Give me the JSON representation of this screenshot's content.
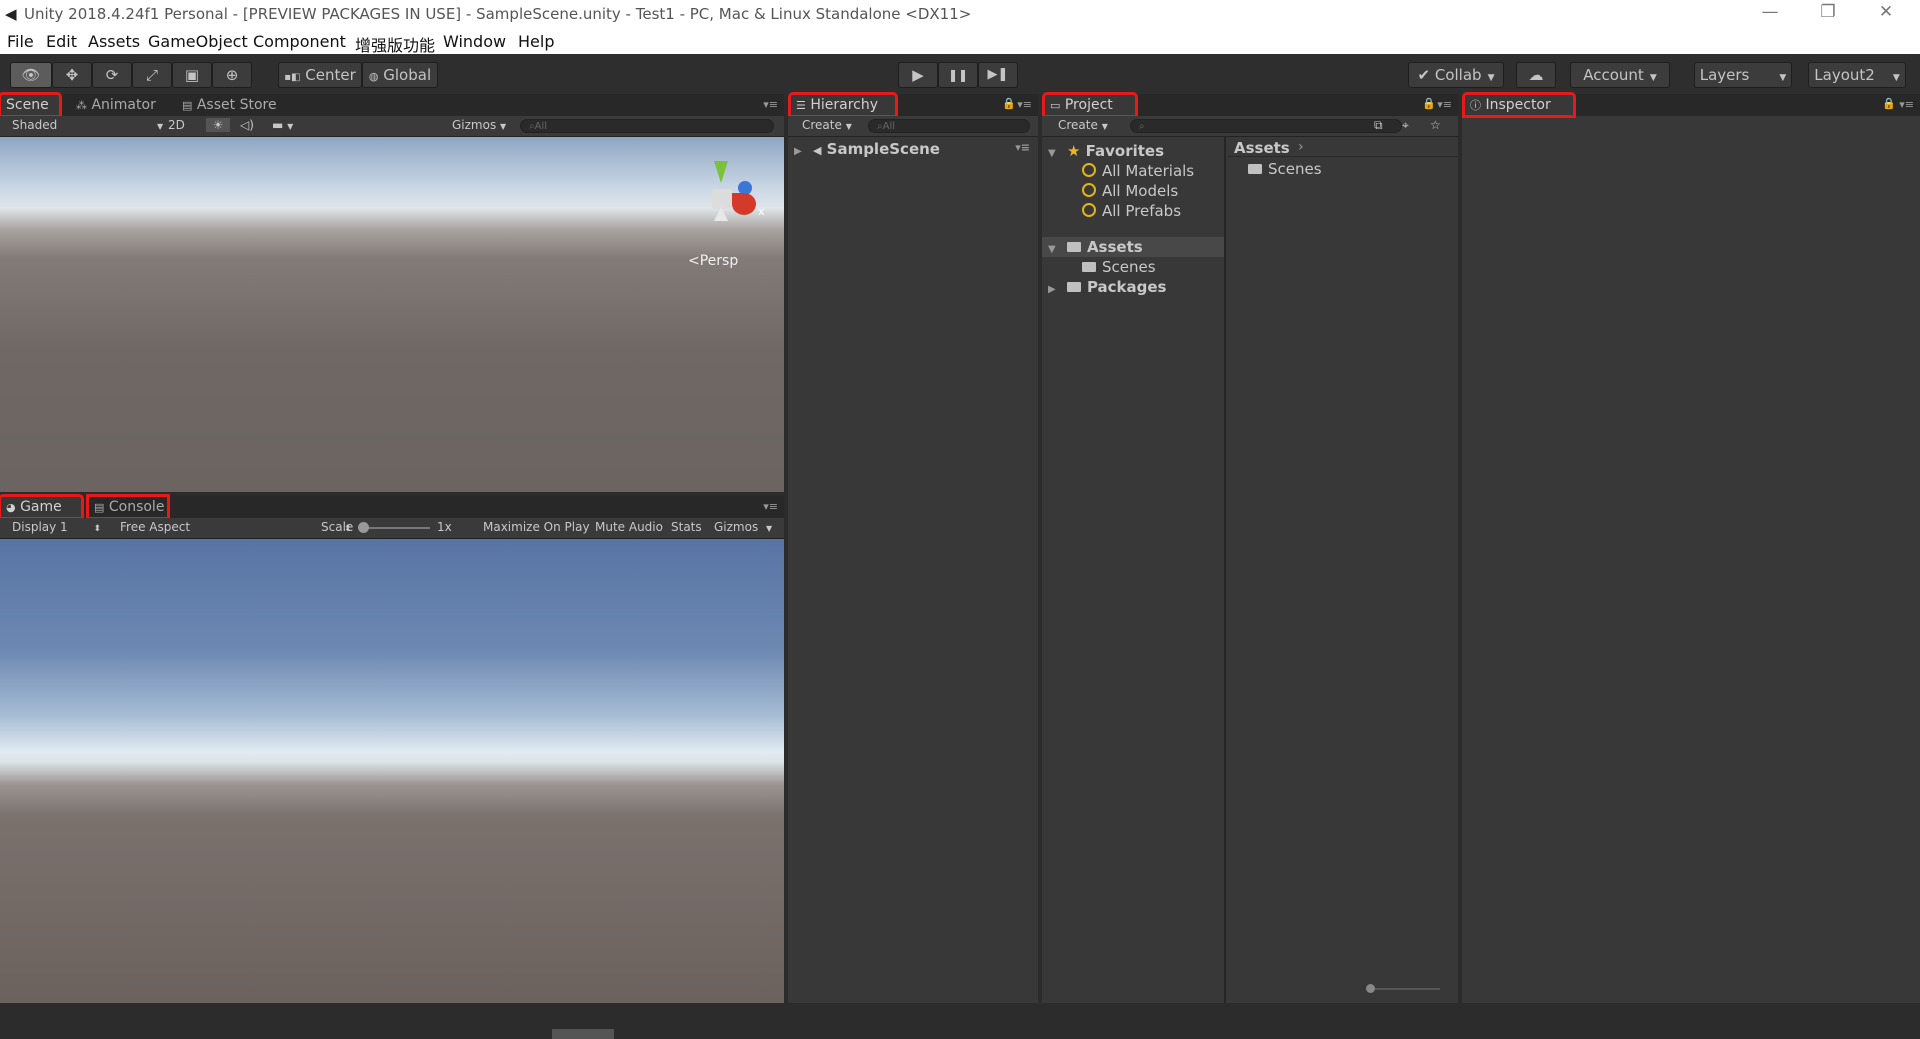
{
  "window": {
    "title": "Unity 2018.4.24f1 Personal - [PREVIEW PACKAGES IN USE] - SampleScene.unity - Test1 - PC, Mac & Linux Standalone <DX11>",
    "minimize": "—",
    "restore": "❐",
    "close": "✕"
  },
  "menu": [
    "File",
    "Edit",
    "Assets",
    "GameObject",
    "Component",
    "增强版功能",
    "Window",
    "Help"
  ],
  "toolbar": {
    "tools": [
      "hand-tool",
      "move-tool",
      "rotate-tool",
      "scale-tool",
      "rect-tool",
      "transform-tool"
    ],
    "pivot_center": "Center",
    "pivot_global": "Global",
    "play": "▶",
    "pause": "❚❚",
    "step": "▶❚",
    "collab": "Collab",
    "account": "Account",
    "layers": "Layers",
    "layout": "Layout2"
  },
  "scene_panel": {
    "tabs": [
      "Scene",
      "Animator",
      "Asset Store"
    ],
    "shading": "Shaded",
    "mode_2d": "2D",
    "gizmos": "Gizmos",
    "search_placeholder": "All",
    "persp_label": "Persp",
    "gizmo_x": "x"
  },
  "game_panel": {
    "tabs": [
      "Game",
      "Console"
    ],
    "display": "Display 1",
    "aspect": "Free Aspect",
    "scale_label": "Scale",
    "scale_value": "1x",
    "maximize": "Maximize On Play",
    "mute": "Mute Audio",
    "stats": "Stats",
    "gizmos": "Gizmos"
  },
  "hierarchy": {
    "tab": "Hierarchy",
    "create": "Create",
    "search_placeholder": "All",
    "scene": "SampleScene"
  },
  "project": {
    "tab": "Project",
    "create": "Create",
    "favorites": "Favorites",
    "favorite_items": [
      "All Materials",
      "All Models",
      "All Prefabs"
    ],
    "assets": "Assets",
    "asset_children": [
      "Scenes"
    ],
    "packages": "Packages",
    "breadcrumb": "Assets",
    "content_items": [
      "Scenes"
    ]
  },
  "inspector": {
    "tab": "Inspector"
  },
  "colors": {
    "highlight": "#e81919",
    "editor_bg": "#383838",
    "sky_game": "#5878a8",
    "ground": "#6b625e"
  }
}
